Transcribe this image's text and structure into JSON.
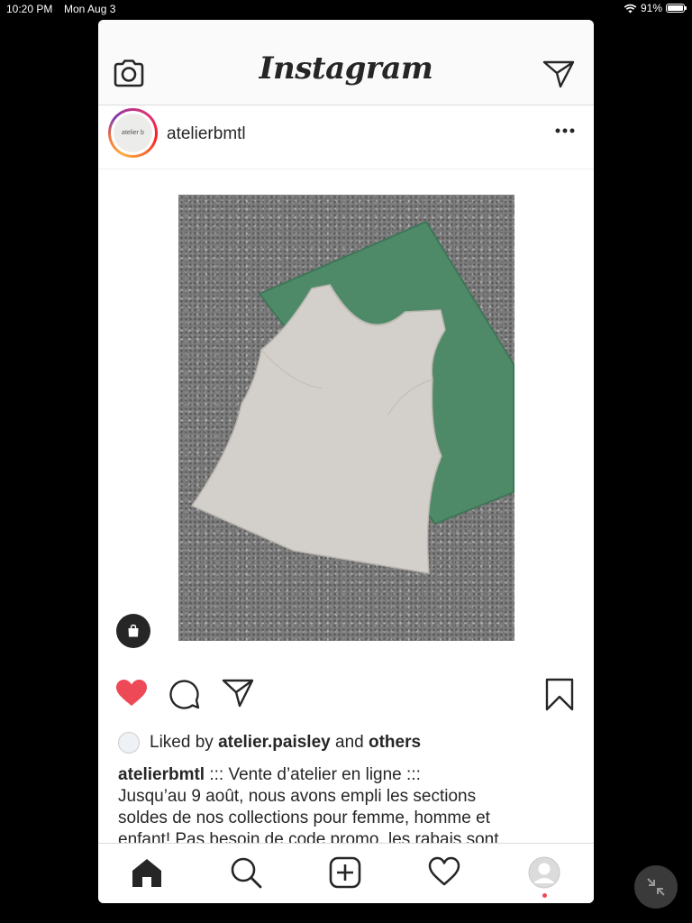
{
  "status_bar": {
    "time": "10:20 PM",
    "date": "Mon Aug 3",
    "battery": "91%",
    "battery_level": 0.91
  },
  "header": {
    "logo": "Instagram",
    "camera_icon": "camera-icon",
    "direct_icon": "paper-plane-icon"
  },
  "post": {
    "username": "atelierbmtl",
    "avatar_text": "atelier b",
    "more_icon": "ellipsis-icon",
    "shopping_icon": "shopping-bag-icon",
    "liked": true,
    "actions": {
      "like_icon": "heart-icon",
      "comment_icon": "comment-icon",
      "share_icon": "paper-plane-icon",
      "save_icon": "bookmark-icon"
    },
    "likes": {
      "prefix": "Liked by",
      "user": "atelier.paisley",
      "conj": "and",
      "others": "others"
    },
    "caption": {
      "username": "atelierbmtl",
      "line1": " ::: Vente d’atelier en ligne :::",
      "line2": "Jusqu’au 9 août, nous avons empli les sections",
      "line3": "soldes de nos collections pour femme, homme et",
      "line4": "enfant! Pas besoin de code promo, les rabais sont"
    }
  },
  "tab_bar": {
    "items": [
      "home-icon",
      "search-icon",
      "new-post-icon",
      "activity-heart-icon",
      "profile-icon"
    ]
  },
  "colors": {
    "like_red": "#ed4956",
    "border": "#dbdbdb",
    "text": "#262626"
  }
}
